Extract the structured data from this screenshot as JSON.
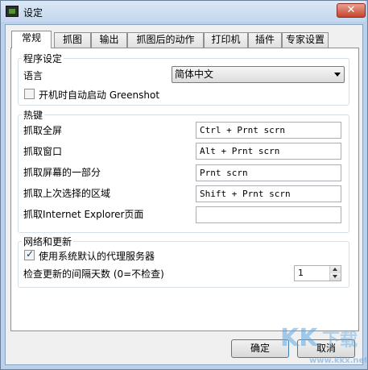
{
  "window": {
    "title": "设定"
  },
  "tabs": [
    "常规",
    "抓图",
    "输出",
    "抓图后的动作",
    "打印机",
    "插件",
    "专家设置"
  ],
  "program_settings": {
    "legend": "程序设定",
    "language_label": "语言",
    "language_value": "简体中文",
    "autostart_label": "开机时自动启动 Greenshot",
    "autostart_checked": false
  },
  "hotkeys": {
    "legend": "热键",
    "rows": [
      {
        "label": "抓取全屏",
        "value": "Ctrl + Prnt scrn"
      },
      {
        "label": "抓取窗口",
        "value": "Alt + Prnt scrn"
      },
      {
        "label": "抓取屏幕的一部分",
        "value": "Prnt scrn"
      },
      {
        "label": "抓取上次选择的区域",
        "value": "Shift + Prnt scrn"
      },
      {
        "label": "抓取Internet Explorer页面",
        "value": ""
      }
    ]
  },
  "network": {
    "legend": "网络和更新",
    "proxy_label": "使用系统默认的代理服务器",
    "proxy_checked": true,
    "update_label": "检查更新的间隔天数 (0=不检查)",
    "update_value": "1"
  },
  "buttons": {
    "ok": "确定",
    "cancel": "取消"
  },
  "watermark": {
    "text": "KK下载",
    "url": "www.kkx.net"
  }
}
